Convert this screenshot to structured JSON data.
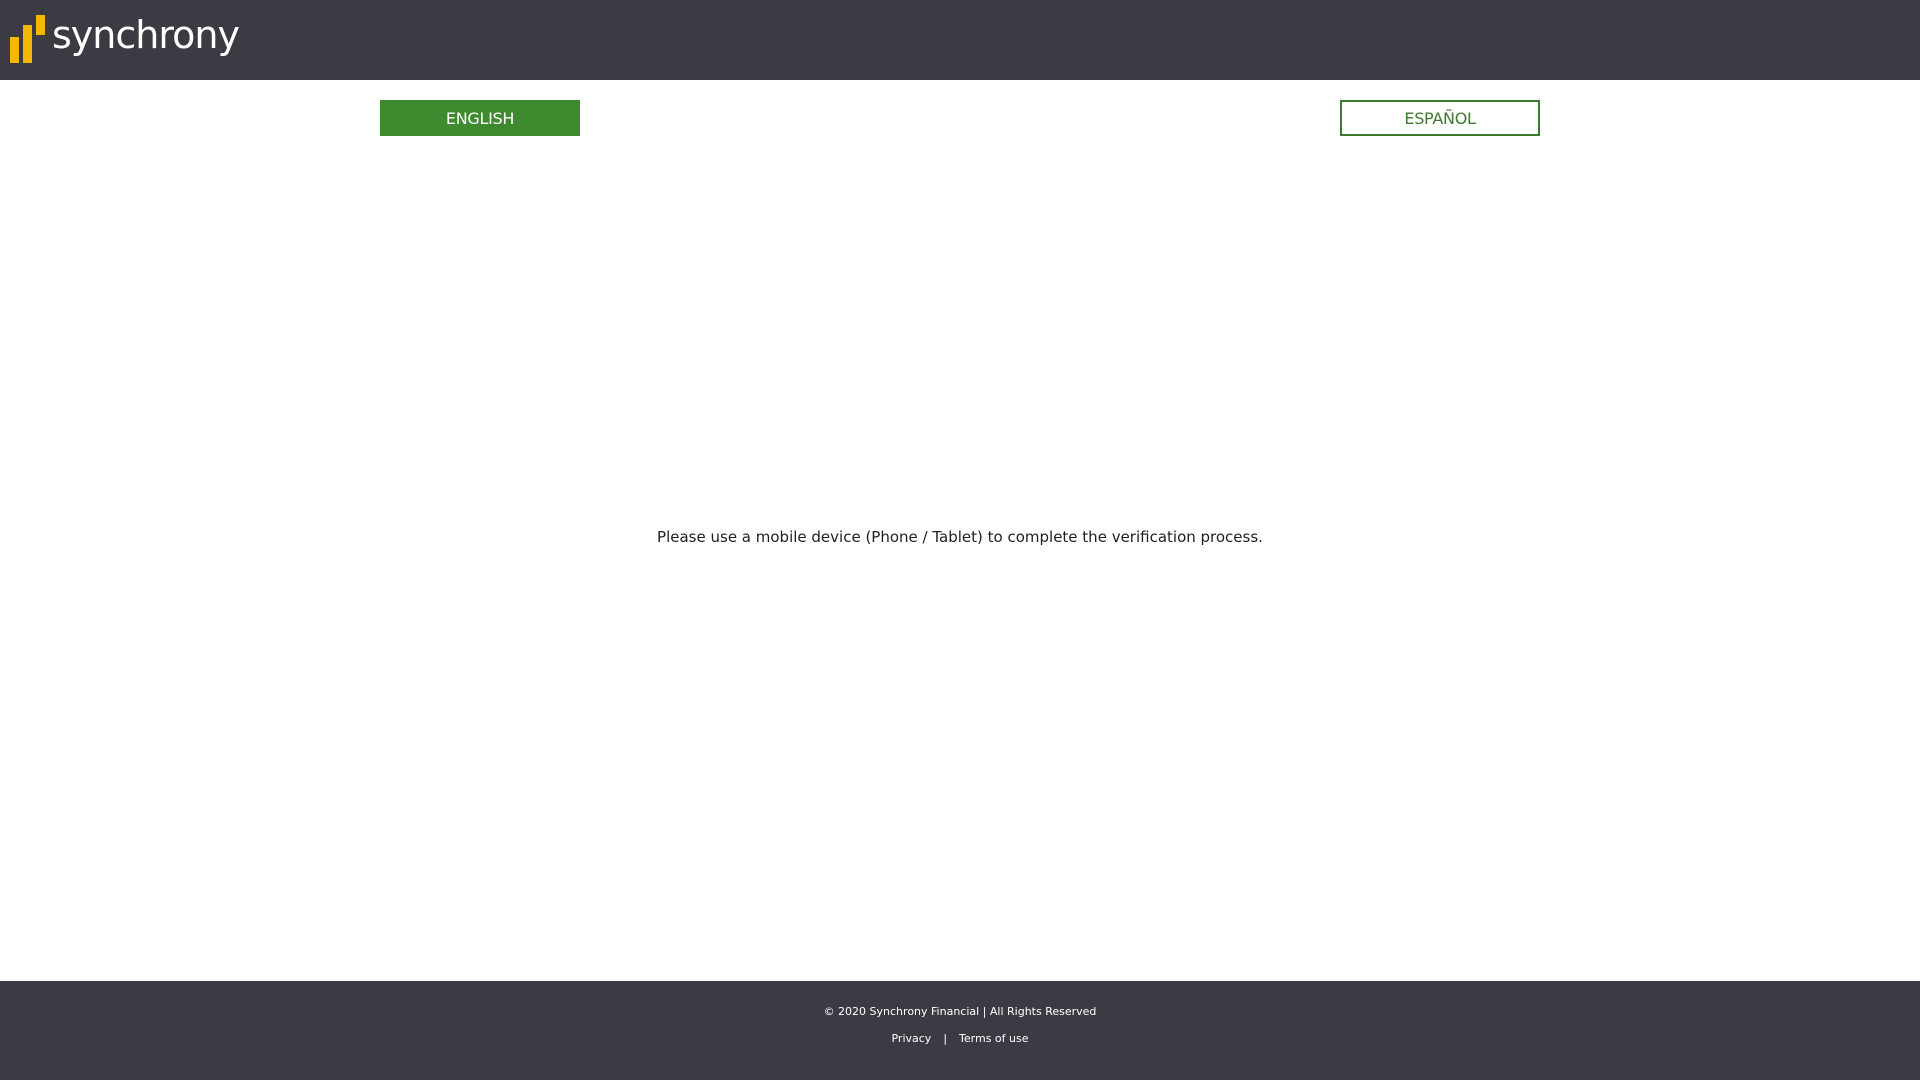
{
  "header": {
    "logo_text": "synchrony",
    "logo_icon": "synchrony-bars-icon",
    "logo_colors": [
      "#f5b800",
      "#f5a623"
    ]
  },
  "language": {
    "english_label": "ENGLISH",
    "spanish_label": "ESPAÑOL",
    "selected": "ENGLISH",
    "accent_color": "#3e8a2f"
  },
  "main": {
    "message": "Please use a mobile device (Phone / Tablet) to complete the verification process."
  },
  "footer": {
    "copyright": "© 2020 Synchrony Financial | All Rights Reserved",
    "links": [
      "Privacy",
      "Terms of use"
    ],
    "separator": "|"
  },
  "colors": {
    "header_bg": "#3b3c43",
    "footer_bg": "#3b3c43"
  }
}
